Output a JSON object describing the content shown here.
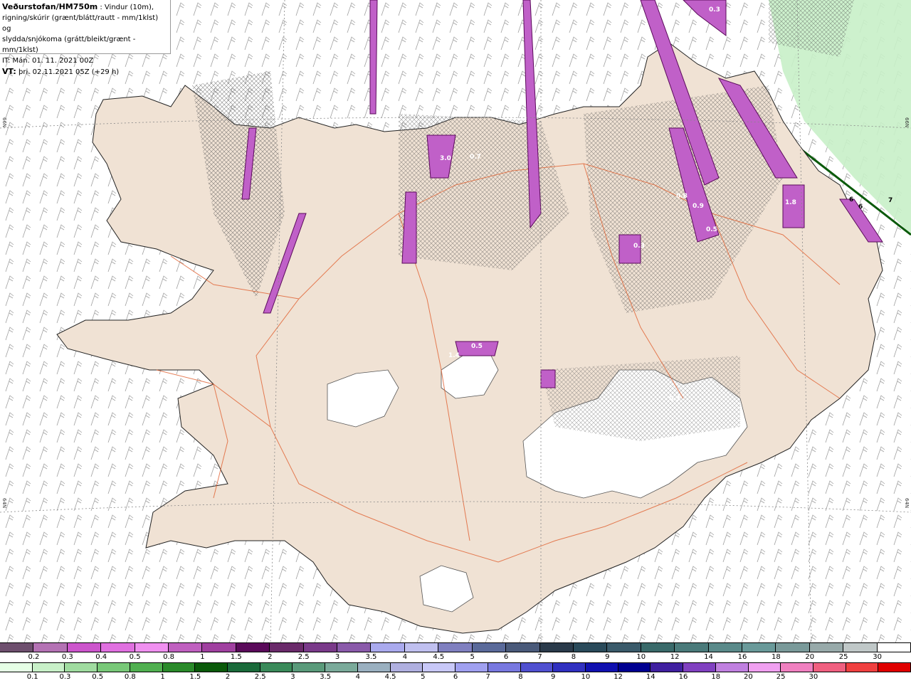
{
  "title": {
    "source": "Veðurstofan/HM750m",
    "line1_suffix": " : Vindur (10m),",
    "line2": "rigning/skúrir (grænt/blátt/rautt - mm/1klst) og",
    "line3": "slydda/snjókoma (grátt/bleikt/grænt - mm/1klst)",
    "line4": "IT: Mán. 01. 11. 2021 00Z",
    "vt_label": "VT:",
    "vt_value": " þri. 02.11.2021 05Z (+29 h)"
  },
  "grid_labels": {
    "left_top": "66N",
    "right_top": "66N",
    "left_bottom": "64N",
    "right_bottom": "64N"
  },
  "map_values": [
    "0.3",
    "3.0",
    "0.7",
    "0.8",
    "1.8",
    "0.9",
    "0.5",
    "0.3",
    "1.4",
    "0.5",
    "0.3",
    "6",
    "6",
    "7"
  ],
  "legend_snow": {
    "colors": [
      "#6e4f6e",
      "#b472b4",
      "#cc55cc",
      "#e070e0",
      "#f090f0",
      "#c060c0",
      "#a040a0",
      "#5a0a5a",
      "#6a2a6a",
      "#7a3a8a",
      "#8a5aaa",
      "#aaaaee",
      "#c0c0f0",
      "#8080c0",
      "#5a6a9a",
      "#4a5a7a",
      "#2a3a4a",
      "#2a4a5a",
      "#3a5a6a",
      "#3a6a6a",
      "#4a7a7a",
      "#5a8a8a",
      "#6a9a9a",
      "#7a9a9a",
      "#98aaaa",
      "#c0c8c8",
      "#ffffff"
    ],
    "labels": [
      "0.2",
      "0.3",
      "0.4",
      "0.5",
      "0.8",
      "1",
      "1.5",
      "2",
      "2.5",
      "3",
      "3.5",
      "4",
      "4.5",
      "5",
      "6",
      "7",
      "8",
      "9",
      "10",
      "12",
      "14",
      "16",
      "18",
      "20",
      "25",
      "30"
    ]
  },
  "legend_rain": {
    "colors": [
      "#e6ffe6",
      "#c8f0c8",
      "#a0dca0",
      "#78c878",
      "#50b050",
      "#2a8a2a",
      "#0a5a0a",
      "#1a6a3a",
      "#3a8a5a",
      "#5a9a7a",
      "#7aaa9a",
      "#9ab0c0",
      "#b0b0e0",
      "#c8c8f8",
      "#a0a0f0",
      "#7878e0",
      "#5050d0",
      "#3030c0",
      "#1010b0",
      "#000090",
      "#4020a0",
      "#8040c0",
      "#c080e0",
      "#f0a0f0",
      "#f080c0",
      "#f06080",
      "#f04040",
      "#e00000"
    ],
    "labels": [
      "0.1",
      "0.3",
      "0.5",
      "0.8",
      "1",
      "1.5",
      "2",
      "2.5",
      "3",
      "3.5",
      "4",
      "4.5",
      "5",
      "6",
      "7",
      "8",
      "9",
      "10",
      "12",
      "14",
      "16",
      "18",
      "20",
      "25",
      "30"
    ]
  }
}
